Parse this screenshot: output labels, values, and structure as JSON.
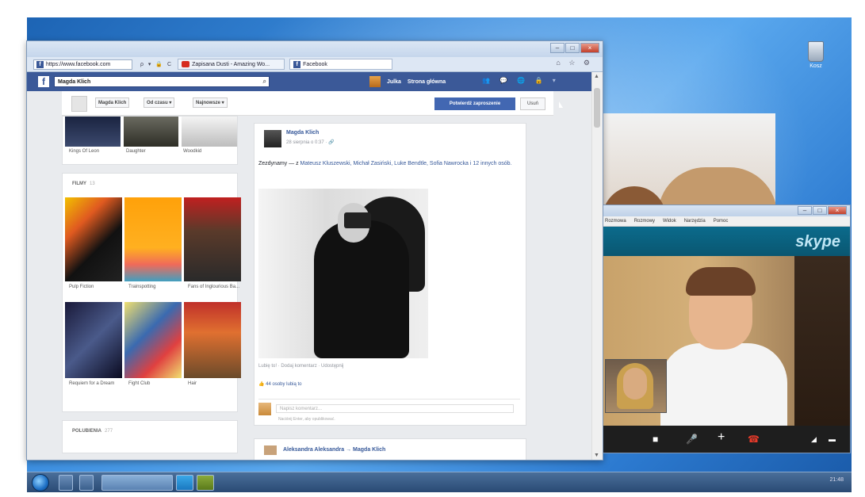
{
  "desktop": {
    "recycle_bin_label": "Kosz"
  },
  "browser": {
    "address": "https://www.facebook.com",
    "nav_icons": "ρ ▾ 🔒 C",
    "tabs": [
      {
        "label": "Zapisana Dusti - Amazing Wo..."
      },
      {
        "label": "Facebook"
      }
    ],
    "toolbar_right": "⌂ ☆ ⚙"
  },
  "facebook": {
    "logo": "f",
    "search_value": "Magda Klich",
    "user_name": "Julka",
    "home_link": "Strona główna",
    "nav_icons": "👥 💬 🌐 🔒 ▾",
    "filters": [
      "Magda Klich",
      "Od czasu ▾",
      "Najnowsze ▾"
    ],
    "confirm_button": "Potwierdź zaproszenie",
    "delete_button": "Usuń",
    "music": {
      "captions": [
        "Kings Of Leon",
        "Daughter",
        "Woodkid"
      ]
    },
    "films": {
      "title": "FILMY",
      "count": "13",
      "items": [
        {
          "caption": "Pulp Fiction"
        },
        {
          "caption": "Trainspotting"
        },
        {
          "caption": "Fans of Inglourious Ba..."
        },
        {
          "caption": "Requiem for a Dream"
        },
        {
          "caption": "Fight Club"
        },
        {
          "caption": "Hair"
        }
      ]
    },
    "likes": {
      "title": "POLUBIENIA",
      "count": "277"
    },
    "post": {
      "author": "Magda Klich",
      "date": "28 sierpnia o 0:37 · 🔗",
      "text_prefix": "Zezdynamy — z",
      "text_links": "Mateusz Kluszewski, Michał Zasiński, Luke Bendtle, Sofia Nawrocka",
      "text_suffix": "i 12 innych osób.",
      "actions": "Lubię to! · Dodaj komentarz · Udostępnij",
      "likes": "👍 44 osoby lubią to",
      "comment_placeholder": "Napisz komentarz...",
      "comment_hint": "Naciśnij Enter, aby opublikować."
    },
    "post2": {
      "author": "Aleksandra Aleksandra → Magda Klich"
    }
  },
  "skype": {
    "menu": [
      "Rozmowa",
      "Rozmowy",
      "Widok",
      "Narzędzia",
      "Pomoc"
    ],
    "logo": "skype",
    "controls": {
      "video": "■",
      "mic": "🎤",
      "add": "+",
      "end": "☎",
      "signal": "◢",
      "chat": "▬"
    }
  },
  "taskbar": {
    "clock": "21:48"
  }
}
